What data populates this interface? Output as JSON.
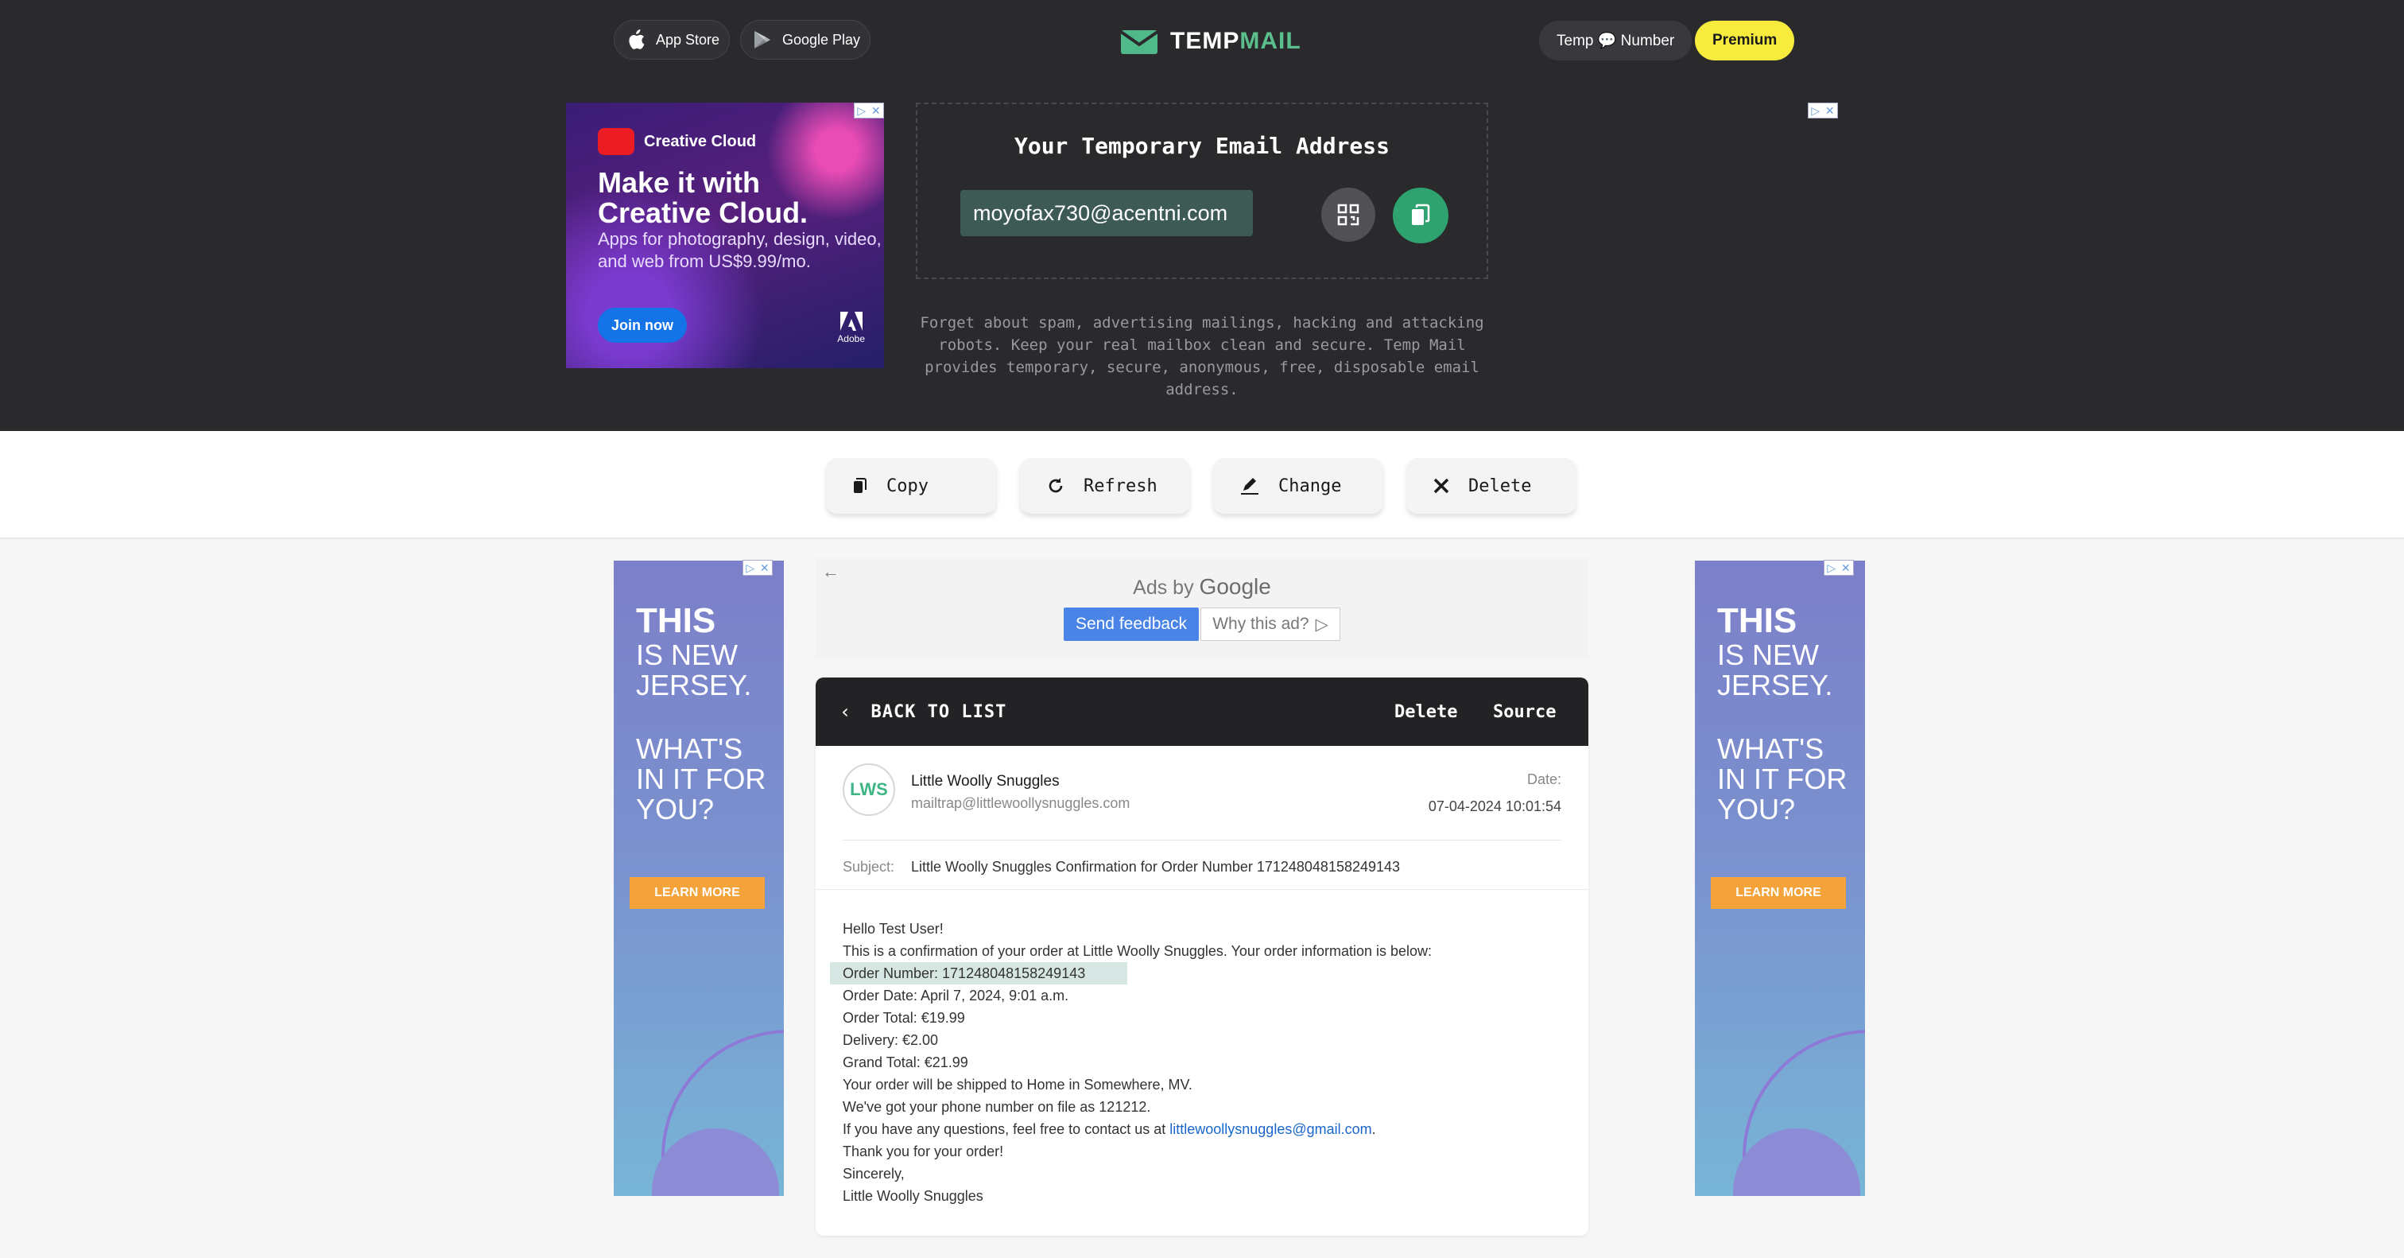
{
  "header": {
    "app_store": "App Store",
    "google_play": "Google Play",
    "logo_main": "TEMP",
    "logo_accent": "MAIL",
    "temp_number": "Temp 💬 Number",
    "premium": "Premium"
  },
  "left_top_ad": {
    "brand": "Creative Cloud",
    "headline_line1": "Make it with",
    "headline_line2": "Creative Cloud.",
    "sub": "Apps for photography, design, video, and web from US$9.99/mo.",
    "cta": "Join now",
    "vendor": "Adobe"
  },
  "email_panel": {
    "title": "Your Temporary Email Address",
    "address": "moyofax730@acentni.com",
    "tagline": "Forget about spam, advertising mailings, hacking and attacking robots. Keep your real mailbox clean and secure. Temp Mail provides temporary, secure, anonymous, free, disposable email address."
  },
  "actions": {
    "copy": "Copy",
    "refresh": "Refresh",
    "change": "Change",
    "delete": "Delete"
  },
  "side_ad": {
    "line1": "THIS",
    "line2": "IS NEW JERSEY.",
    "line3": "WHAT'S IN IT FOR YOU?",
    "cta": "LEARN MORE"
  },
  "google_ads": {
    "ads_by": "Ads by",
    "google": "Google",
    "feedback": "Send feedback",
    "why": "Why this ad?"
  },
  "message": {
    "back": "BACK TO LIST",
    "delete": "Delete",
    "source": "Source",
    "avatar_initials": "LWS",
    "sender_name": "Little Woolly Snuggles",
    "sender_email": "mailtrap@littlewoollysnuggles.com",
    "date_label": "Date:",
    "date_value": "07-04-2024 10:01:54",
    "subject_label": "Subject:",
    "subject": "Little Woolly Snuggles Confirmation for Order Number 171248048158249143",
    "body": {
      "greeting": "Hello Test User!",
      "intro": "This is a confirmation of your order at Little Woolly Snuggles. Your order information is below:",
      "order_number": "Order Number: 171248048158249143",
      "order_date": "Order Date: April 7, 2024, 9:01 a.m.",
      "order_total": "Order Total: €19.99",
      "delivery": "Delivery: €2.00",
      "grand_total": "Grand Total: €21.99",
      "shipping": "Your order will be shipped to Home in Somewhere, MV.",
      "phone": "We've got your phone number on file as 121212.",
      "questions_prefix": "If you have any questions, feel free to contact us at ",
      "contact_email": "littlewoollysnuggles@gmail.com",
      "questions_suffix": ".",
      "thanks": "Thank you for your order!",
      "closing": "Sincerely,",
      "signature": "Little Woolly Snuggles"
    }
  },
  "colors": {
    "dark_band": "#2a2a2d",
    "accent_green": "#2fa36f",
    "premium_yellow": "#f7ec3d",
    "link_blue": "#1a66cc"
  }
}
